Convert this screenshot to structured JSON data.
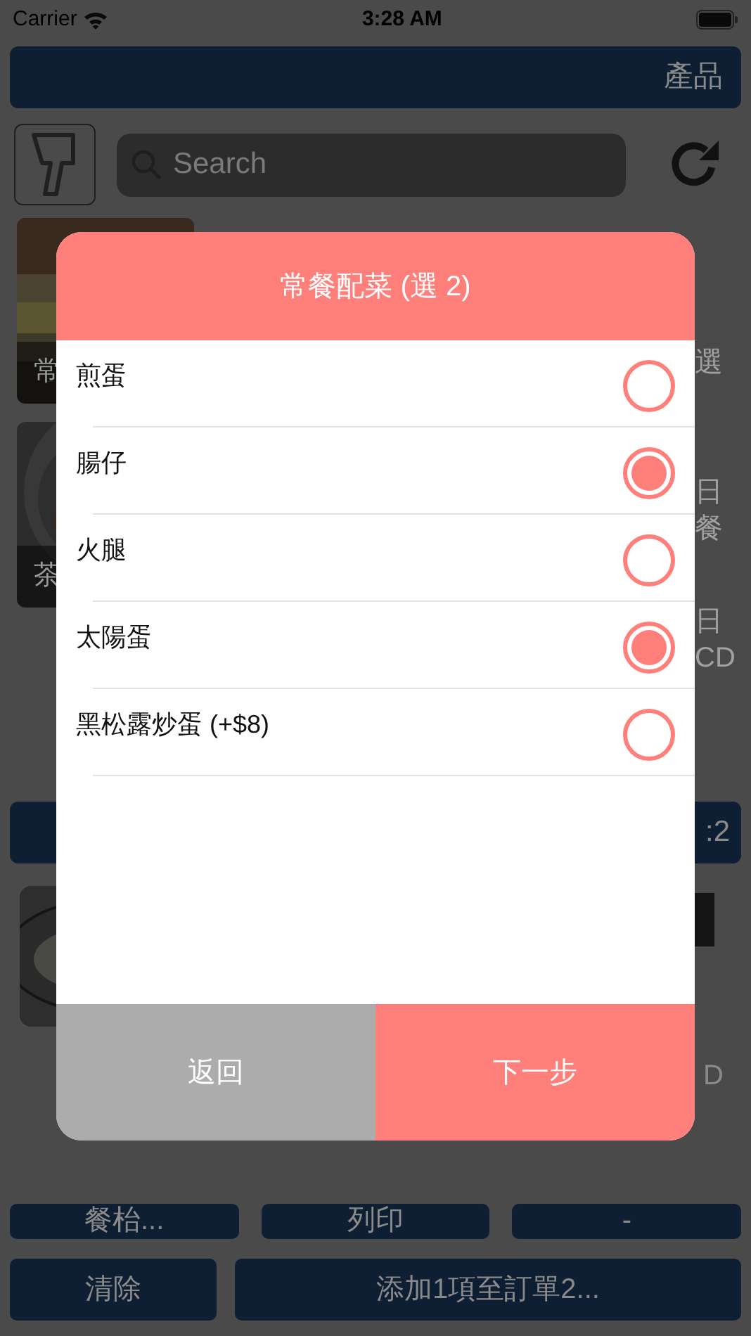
{
  "status_bar": {
    "carrier": "Carrier",
    "time": "3:28 AM"
  },
  "header": {
    "title": "產品"
  },
  "search": {
    "placeholder": "Search"
  },
  "product_tiles": [
    {
      "label": "常"
    },
    {
      "label": "茶"
    }
  ],
  "side_fragments": [
    {
      "lines": [
        "選"
      ]
    },
    {
      "lines": [
        "日",
        "餐"
      ]
    },
    {
      "lines": [
        "日",
        "CD"
      ]
    }
  ],
  "order_bar": {
    "text": ":2"
  },
  "order_item": {
    "price_fragment": "D"
  },
  "footer_buttons": [
    [
      "餐枱...",
      "列印",
      "-"
    ],
    [
      "清除",
      "添加1項至訂單2..."
    ]
  ],
  "dialog": {
    "title": "常餐配菜 (選 2)",
    "options": [
      {
        "label": "煎蛋",
        "selected": false
      },
      {
        "label": "腸仔",
        "selected": true
      },
      {
        "label": "火腿",
        "selected": false
      },
      {
        "label": "太陽蛋",
        "selected": true
      },
      {
        "label": "黑松露炒蛋 (+$8)",
        "selected": false
      }
    ],
    "buttons": [
      {
        "label": "返回",
        "kind": "secondary"
      },
      {
        "label": "下一步",
        "kind": "primary"
      }
    ]
  }
}
